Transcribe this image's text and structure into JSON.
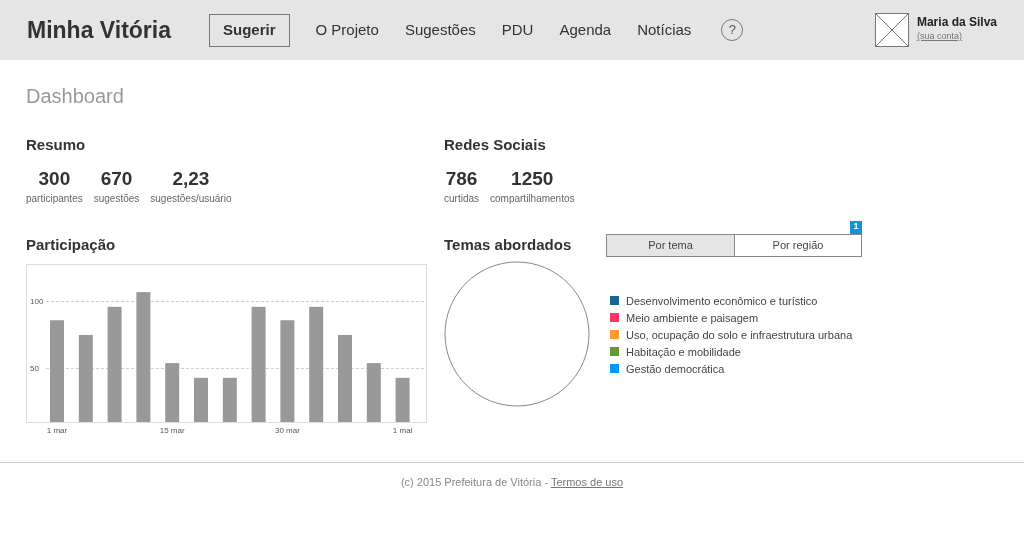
{
  "header": {
    "logo": "Minha Vitória",
    "suggest_button": "Sugerir",
    "nav": [
      {
        "label": "O Projeto"
      },
      {
        "label": "Sugestões"
      },
      {
        "label": "PDU"
      },
      {
        "label": "Agenda"
      },
      {
        "label": "Notícias"
      },
      {
        "label": "?",
        "kind": "help"
      }
    ],
    "user": {
      "name": "Maria da Silva",
      "account_link": "(sua conta)"
    }
  },
  "page_title": "Dashboard",
  "summary": {
    "title": "Resumo",
    "stats": [
      {
        "value": "300",
        "label": "participantes"
      },
      {
        "value": "670",
        "label": "sugestões"
      },
      {
        "value": "2,23",
        "label": "sugestões/usuário"
      }
    ]
  },
  "social": {
    "title": "Redes Sociais",
    "stats": [
      {
        "value": "786",
        "label": "curtidas"
      },
      {
        "value": "1250",
        "label": "compartilhamentos"
      }
    ]
  },
  "participation": {
    "title": "Participação",
    "chart_data": {
      "type": "bar",
      "categories": [
        "1 mar",
        null,
        null,
        null,
        "15 mar",
        null,
        null,
        null,
        "30 mar",
        null,
        null,
        null,
        "1 mai"
      ],
      "ylim": [
        10,
        128
      ],
      "yticks": [
        50,
        100
      ],
      "series": [
        {
          "color": "#999999",
          "values": [
            86,
            75,
            96,
            107,
            54,
            43,
            43,
            96,
            86,
            96,
            75,
            54,
            43
          ]
        }
      ]
    }
  },
  "themes": {
    "title": "Temas abordados",
    "tabs": [
      {
        "label": "Por tema",
        "selected": true
      },
      {
        "label": "Por região",
        "selected": false,
        "badge": "1"
      }
    ],
    "legend": [
      {
        "label": "Desenvolvimento econômico e turístico",
        "color": "#1a6496"
      },
      {
        "label": "Meio ambiente e paisagem",
        "color": "#ff3366"
      },
      {
        "label": "Uso, ocupação do solo e infraestrutura urbana",
        "color": "#ff9933"
      },
      {
        "label": "Habitação e mobilidade",
        "color": "#669933"
      },
      {
        "label": "Gestão democrática",
        "color": "#0099ff"
      }
    ]
  },
  "footer": {
    "text": "(c) 2015 Prefeitura de Vitória - ",
    "link": "Termos de uso"
  }
}
